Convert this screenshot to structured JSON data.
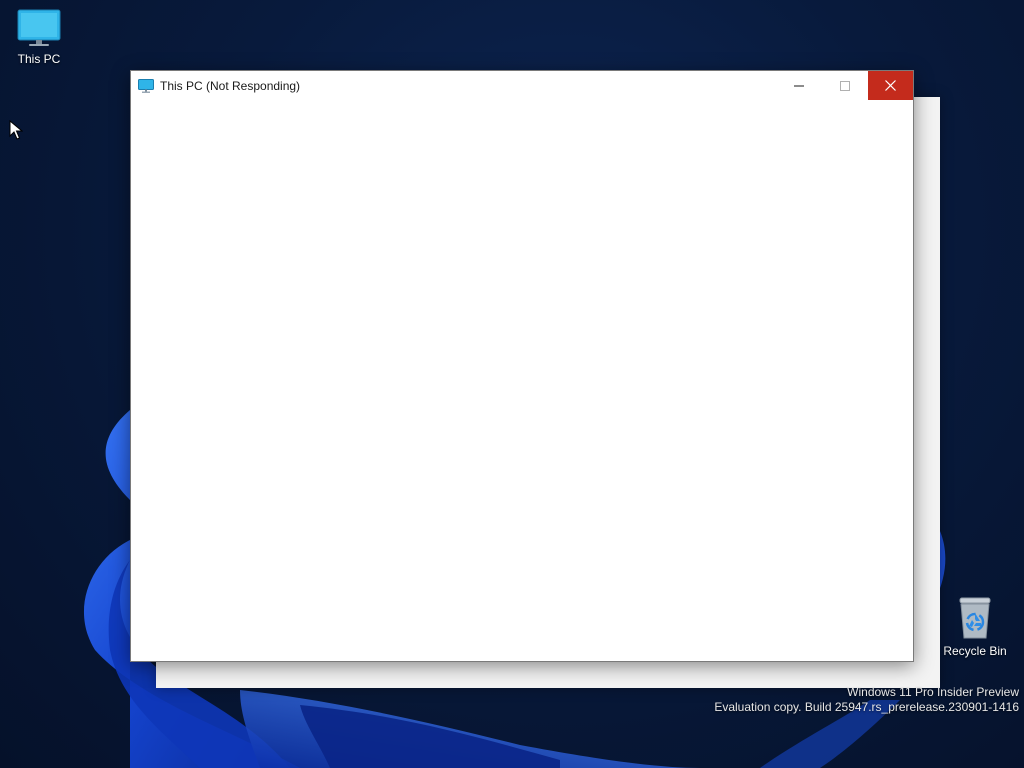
{
  "desktop": {
    "icons": [
      {
        "label": "This PC",
        "icon": "monitor-icon"
      },
      {
        "label": "Recycle Bin",
        "icon": "recycle-bin-icon"
      }
    ],
    "watermark": {
      "line1": "Windows 11 Pro Insider Preview",
      "line2": "Evaluation copy. Build 25947.rs_prerelease.230901-1416"
    }
  },
  "window": {
    "title": "This PC (Not Responding)",
    "icon": "monitor-icon",
    "state": "not-responding",
    "controls": {
      "minimize": "minimize-icon",
      "maximize": "maximize-icon",
      "close": "close-icon"
    }
  },
  "colors": {
    "wallpaper_dark": "#05112a",
    "bloom_blue": "#1d4fd8",
    "close_button_red": "#c42b1c",
    "icon_cyan": "#35b9e6"
  }
}
